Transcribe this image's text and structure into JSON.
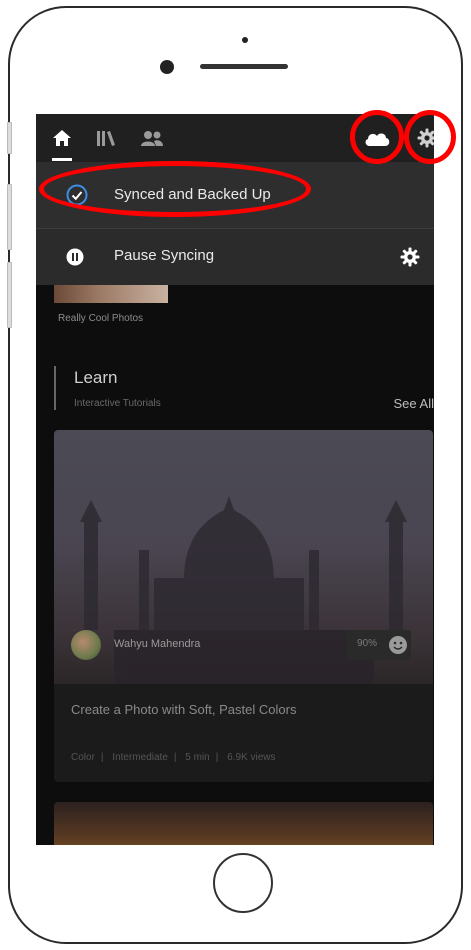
{
  "device": {
    "screen_bg": "#0d0d0d",
    "highlight_color": "#ff0000"
  },
  "topbar": {
    "nav_icons": [
      "home-icon",
      "library-icon",
      "people-icon"
    ],
    "right_icons": [
      "cloud-icon",
      "gear-icon"
    ]
  },
  "sync_menu": {
    "status_label": "Synced and Backed Up",
    "status_icon": "check-circle-icon",
    "pause_label": "Pause Syncing",
    "pause_icon": "pause-icon",
    "settings_icon": "gear-icon"
  },
  "albums": {
    "label": "Really Cool Photos"
  },
  "learn": {
    "title": "Learn",
    "subtitle": "Interactive Tutorials",
    "see_all": "See All",
    "card": {
      "author": "Wahyu Mahendra",
      "rating": "90%",
      "title": "Create a Photo with Soft, Pastel Colors",
      "tags": [
        "Color",
        "Intermediate",
        "5 min",
        "6.9K views"
      ]
    }
  }
}
